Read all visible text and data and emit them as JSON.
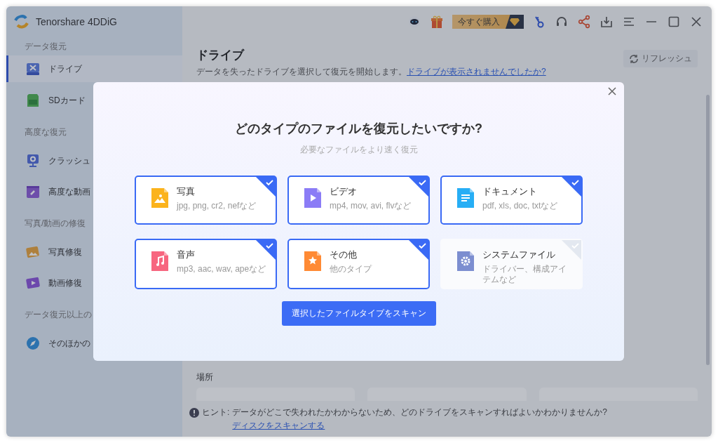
{
  "app": {
    "title": "Tenorshare 4DDiG",
    "buy_button": "今すぐ購入"
  },
  "sidebar": {
    "items": [
      {
        "kind": "section",
        "label": "データ復元"
      },
      {
        "kind": "item",
        "label": "ドライブ",
        "selected": true
      },
      {
        "kind": "item",
        "label": "SDカード",
        "selected": false
      },
      {
        "kind": "section",
        "label": "高度な復元"
      },
      {
        "kind": "item",
        "label": "クラッシュ",
        "selected": false
      },
      {
        "kind": "item",
        "label": "高度な動画",
        "selected": false
      },
      {
        "kind": "section",
        "label": "写真/動画の修復"
      },
      {
        "kind": "item",
        "label": "写真修復",
        "selected": false
      },
      {
        "kind": "item",
        "label": "動画修復",
        "selected": false
      },
      {
        "kind": "section",
        "label": "データ復元以上の"
      },
      {
        "kind": "item",
        "label": "そのほかの",
        "selected": false
      }
    ]
  },
  "main": {
    "title": "ドライブ",
    "subtitle": "データを失ったドライブを選択して復元を開始します。",
    "subtitle_link": "ドライブが表示されませんでしたか?",
    "refresh_button": "リフレッシュ",
    "location_label": "場所",
    "hint": {
      "label": "ヒント:",
      "text": "データがどこで失われたかわからないため、どのドライブをスキャンすればよいかわかりませんか?",
      "link": "ディスクをスキャンする"
    }
  },
  "dialog": {
    "title": "どのタイプのファイルを復元したいですか?",
    "subtitle": "必要なファイルをより速く復元",
    "file_types": [
      {
        "kind": "photo",
        "name": "写真",
        "formats": "jpg, png, cr2, nefなど",
        "selected": true
      },
      {
        "kind": "video",
        "name": "ビデオ",
        "formats": "mp4, mov, avi, flvなど",
        "selected": true
      },
      {
        "kind": "document",
        "name": "ドキュメント",
        "formats": "pdf, xls, doc, txtなど",
        "selected": true
      },
      {
        "kind": "audio",
        "name": "音声",
        "formats": "mp3, aac, wav, apeなど",
        "selected": true
      },
      {
        "kind": "other",
        "name": "その他",
        "formats": "他のタイプ",
        "selected": true
      },
      {
        "kind": "system",
        "name": "システムファイル",
        "formats": "ドライバー、構成アイテムなど",
        "selected": false
      }
    ],
    "scan_button": "選択したファイルタイプをスキャン"
  }
}
